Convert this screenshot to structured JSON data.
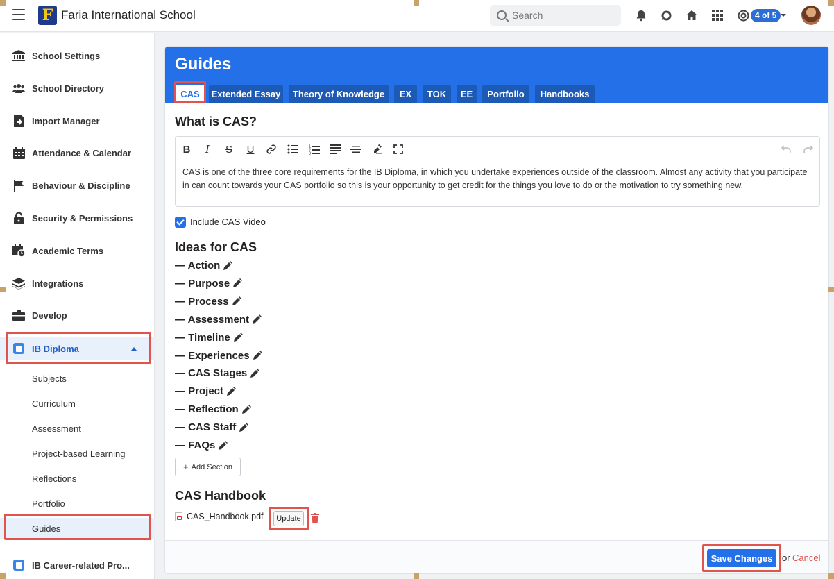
{
  "header": {
    "school_name": "Faria International School",
    "logo_letter": "F",
    "search_placeholder": "Search",
    "notifications_badge": "4 of 5"
  },
  "sidebar": {
    "items": [
      {
        "label": "School Settings",
        "icon": "bank-icon"
      },
      {
        "label": "School Directory",
        "icon": "users-icon"
      },
      {
        "label": "Import Manager",
        "icon": "import-icon"
      },
      {
        "label": "Attendance & Calendar",
        "icon": "calendar-icon"
      },
      {
        "label": "Behaviour & Discipline",
        "icon": "flag-icon"
      },
      {
        "label": "Security & Permissions",
        "icon": "lock-icon"
      },
      {
        "label": "Academic Terms",
        "icon": "calendar-clock-icon"
      },
      {
        "label": "Integrations",
        "icon": "layers-icon"
      },
      {
        "label": "Develop",
        "icon": "briefcase-icon"
      }
    ],
    "ib_diploma": {
      "label": "IB Diploma",
      "sub_items": [
        "Subjects",
        "Curriculum",
        "Assessment",
        "Project-based Learning",
        "Reflections",
        "Portfolio",
        "Guides"
      ],
      "active_sub": "Guides"
    },
    "ib_career": {
      "label": "IB Career-related Pro..."
    }
  },
  "main": {
    "title": "Guides",
    "tabs": [
      "CAS",
      "Extended Essay",
      "Theory of Knowledge",
      "EX",
      "TOK",
      "EE",
      "Portfolio",
      "Handbooks"
    ],
    "active_tab": "CAS",
    "what_is_heading": "What is CAS?",
    "editor_text": "CAS is one of the three core requirements for the IB Diploma, in which you undertake experiences outside of the classroom. Almost any activity that you participate in can count towards your CAS portfolio so this is your opportunity to get credit for the things you love to do or the motivation to try something new.",
    "include_video_label": "Include CAS Video",
    "include_video_checked": true,
    "ideas_heading": "Ideas for CAS",
    "ideas": [
      "— Action",
      "— Purpose",
      "— Process",
      "— Assessment",
      "— Timeline",
      "— Experiences",
      "— CAS Stages",
      "— Project",
      "— Reflection",
      "— CAS Staff",
      "— FAQs"
    ],
    "add_section_label": "Add Section",
    "handbook_heading": "CAS Handbook",
    "handbook_file": "CAS_Handbook.pdf",
    "update_label": "Update",
    "save_label": "Save Changes",
    "or_text": "or",
    "cancel_label": "Cancel"
  },
  "colors": {
    "accent": "#2470e9",
    "highlight": "#e0544d",
    "cancel": "#e0544d"
  }
}
